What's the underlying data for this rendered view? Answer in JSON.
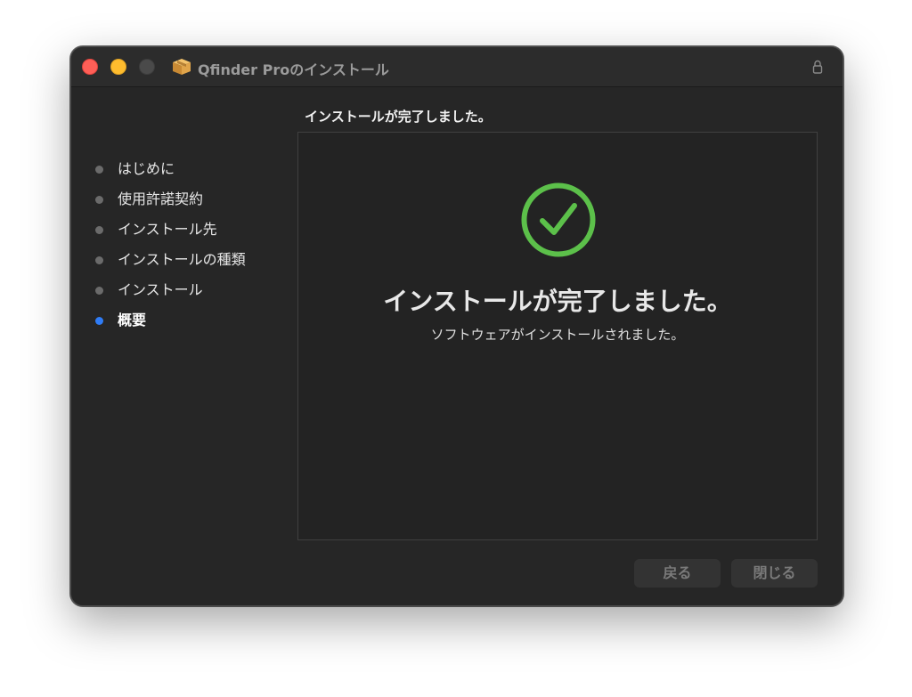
{
  "window": {
    "title": "Qfinder Proのインストール",
    "icons": {
      "app": "package-icon",
      "lock": "lock-icon"
    }
  },
  "sidebar": {
    "steps": [
      {
        "label": "はじめに",
        "active": false
      },
      {
        "label": "使用許諾契約",
        "active": false
      },
      {
        "label": "インストール先",
        "active": false
      },
      {
        "label": "インストールの種類",
        "active": false
      },
      {
        "label": "インストール",
        "active": false
      },
      {
        "label": "概要",
        "active": true
      }
    ]
  },
  "main": {
    "header": "インストールが完了しました。",
    "result_title": "インストールが完了しました。",
    "result_subtitle": "ソフトウェアがインストールされました。",
    "icon": "checkmark-circle-icon"
  },
  "footer": {
    "back_label": "戻る",
    "close_label": "閉じる"
  },
  "colors": {
    "accent": "#2f7cf6",
    "success": "#5cc04a",
    "close_button": "#ff5f57",
    "minimize_button": "#febc2e"
  }
}
